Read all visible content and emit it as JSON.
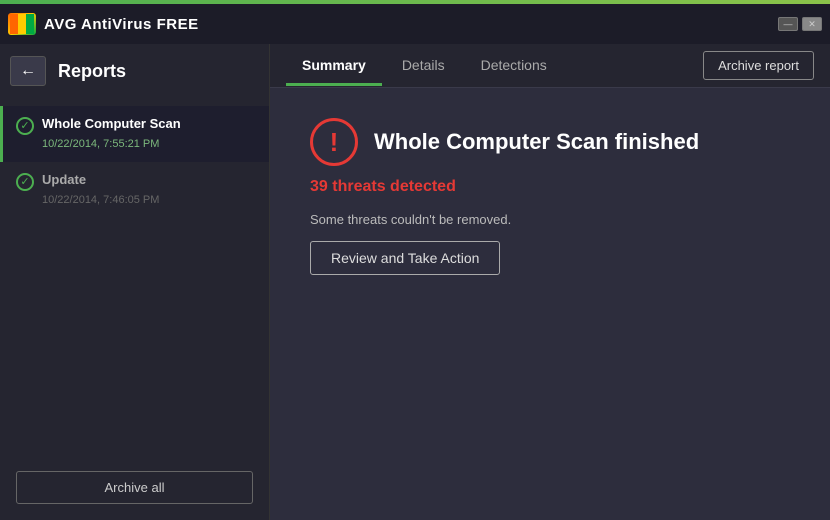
{
  "app": {
    "logo_text": "AVG",
    "title": "AntiVirusFREE",
    "title_display": "AVG  AntiVirus FREE"
  },
  "window_controls": {
    "minimize_label": "—",
    "close_label": "✕"
  },
  "sidebar": {
    "title": "Reports",
    "back_button_label": "←",
    "items": [
      {
        "name": "Whole Computer Scan",
        "date": "10/22/2014, 7:55:21 PM",
        "active": true
      },
      {
        "name": "Update",
        "date": "10/22/2014, 7:46:05 PM",
        "active": false
      }
    ],
    "archive_all_label": "Archive all"
  },
  "tabs": [
    {
      "label": "Summary",
      "active": true
    },
    {
      "label": "Details",
      "active": false
    },
    {
      "label": "Detections",
      "active": false
    }
  ],
  "archive_report_button": "Archive report",
  "summary": {
    "scan_finished_text": "Whole Computer Scan finished",
    "threats_text": "39 threats detected",
    "cant_remove_text": "Some threats couldn't be removed.",
    "review_button": "Review and Take Action"
  }
}
